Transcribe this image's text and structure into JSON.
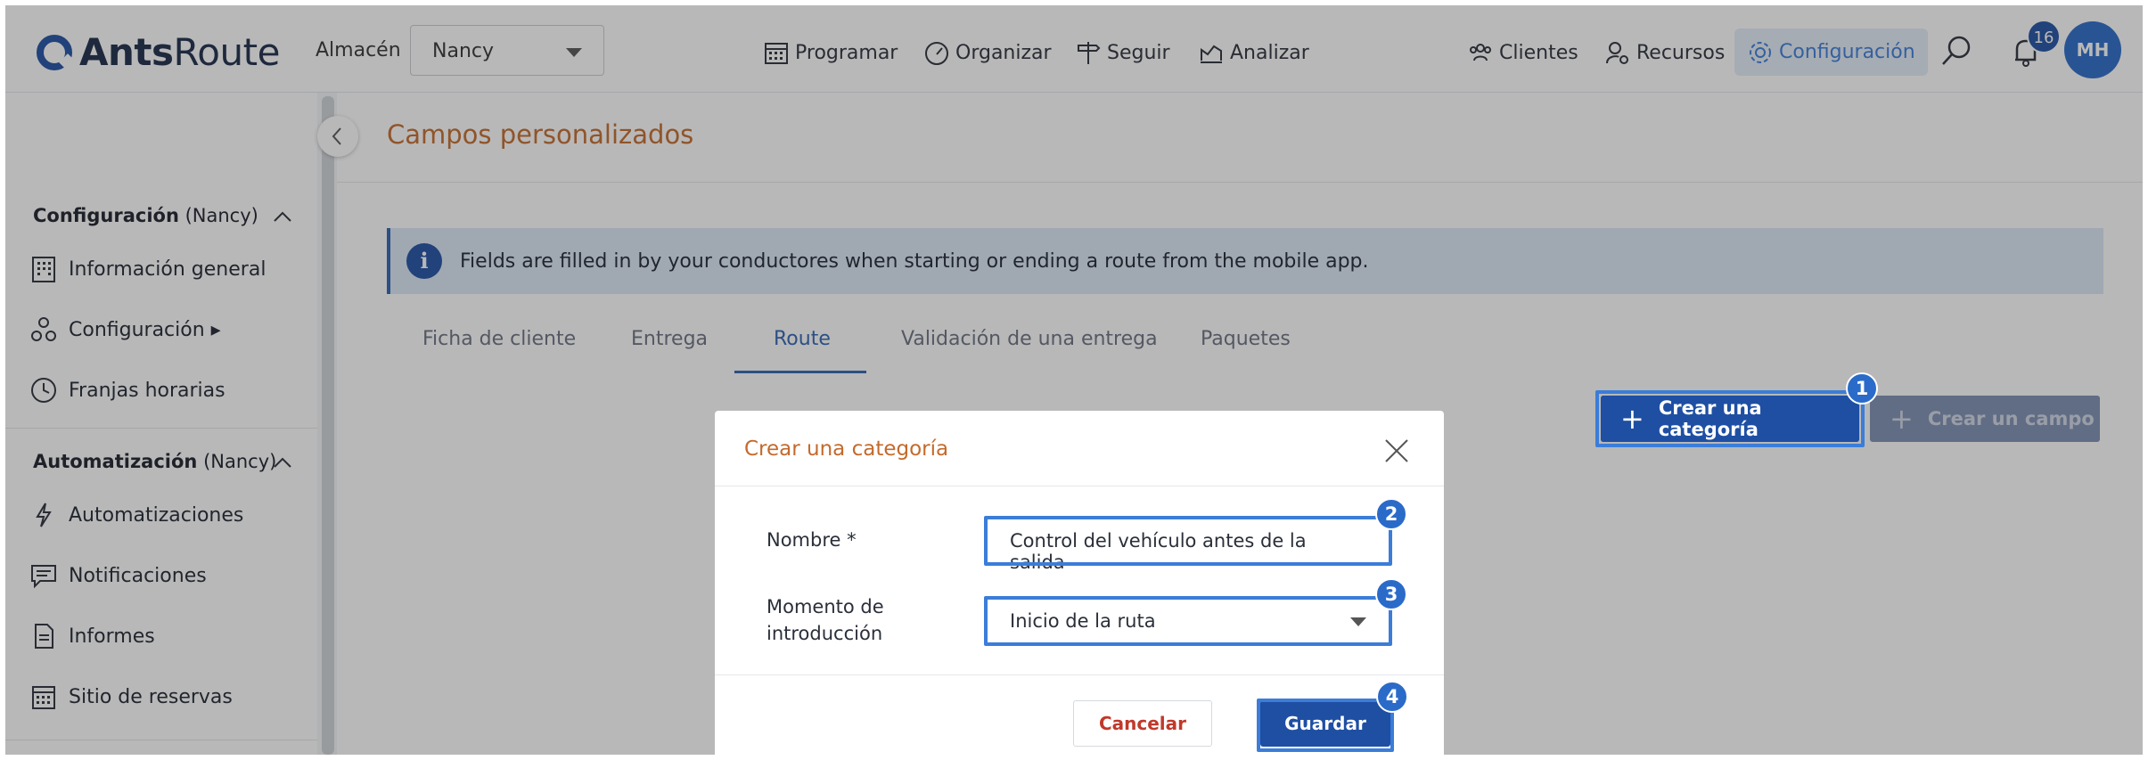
{
  "brand": {
    "name_bold": "Ants",
    "name_regular": "Route"
  },
  "header": {
    "warehouse_label": "Almacén",
    "warehouse_value": "Nancy",
    "nav": {
      "schedule": "Programar",
      "organize": "Organizar",
      "track": "Seguir",
      "analyze": "Analizar",
      "clients": "Clientes",
      "resources": "Recursos",
      "settings": "Configuración"
    },
    "notifications_count": "16",
    "user_initials": "MH"
  },
  "sidebar": {
    "section1": {
      "title": "Configuración",
      "scope": "(Nancy)"
    },
    "section1_items": [
      {
        "label": "Información general",
        "icon": "building-icon"
      },
      {
        "label": "Configuración ▸",
        "icon": "nodes-icon"
      },
      {
        "label": "Franjas horarias",
        "icon": "clock-icon"
      }
    ],
    "section2": {
      "title": "Automatización",
      "scope": "(Nancy)"
    },
    "section2_items": [
      {
        "label": "Automatizaciones",
        "icon": "lightning-icon"
      },
      {
        "label": "Notificaciones",
        "icon": "message-icon"
      },
      {
        "label": "Informes",
        "icon": "document-icon"
      },
      {
        "label": "Sitio de reservas",
        "icon": "calendar-icon"
      }
    ]
  },
  "main": {
    "title": "Campos personalizados",
    "info_icon": "i",
    "info_text": "Fields are filled in by your conductores when starting or ending a route from the mobile app.",
    "tabs": [
      "Ficha de cliente",
      "Entrega",
      "Route",
      "Validación de una entrega",
      "Paquetes"
    ],
    "active_tab": "Route",
    "plus_glyph": "+",
    "create_category": "Crear una categoría",
    "create_field": "Crear un campo"
  },
  "modal": {
    "title": "Crear una categoría",
    "name_label": "Nombre *",
    "name_value": "Control del vehículo antes de la salida",
    "moment_label_line1": "Momento de",
    "moment_label_line2": "introducción",
    "moment_value": "Inicio de la ruta",
    "cancel": "Cancelar",
    "save": "Guardar"
  },
  "steps": [
    "1",
    "2",
    "3",
    "4"
  ],
  "colors": {
    "primary": "#1e4fa3",
    "accent": "#3b7dd8",
    "title": "#c46a2c",
    "danger": "#c0392b"
  }
}
